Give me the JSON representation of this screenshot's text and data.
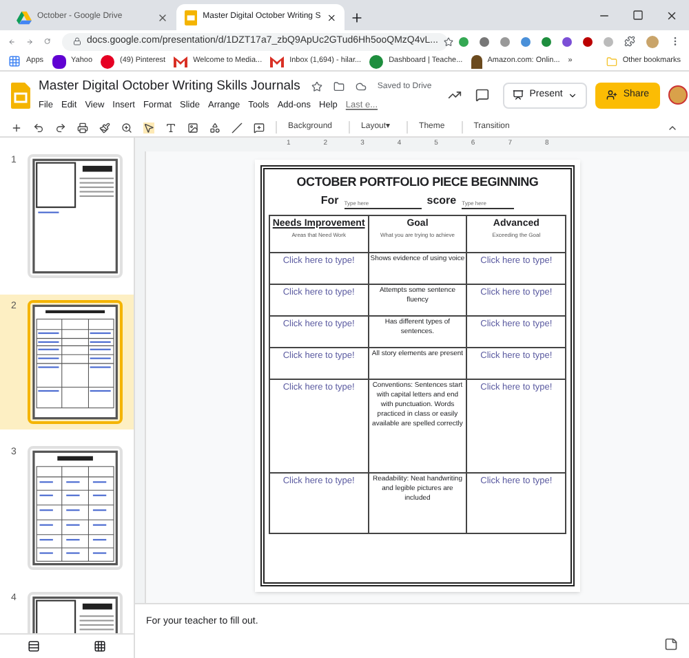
{
  "browser": {
    "tabs": [
      {
        "title": "October - Google Drive",
        "selected": false,
        "kind": "drive"
      },
      {
        "title": "Master Digital October Writing S",
        "selected": true,
        "kind": "slides"
      }
    ],
    "url": "docs.google.com/presentation/d/1DZT17a7_zbQ9ApUc2GTud6Hh5ooQMzQ4vL...",
    "bookmarks": [
      {
        "label": "Apps",
        "kind": "apps"
      },
      {
        "label": "Yahoo",
        "kind": "yahoo"
      },
      {
        "label": "(49) Pinterest",
        "kind": "pinterest"
      },
      {
        "label": "Welcome to Media...",
        "kind": "mail"
      },
      {
        "label": "Inbox (1,694) - hilar...",
        "kind": "mail"
      },
      {
        "label": "Dashboard | Teache...",
        "kind": "dash"
      },
      {
        "label": "Amazon.com: Onlin...",
        "kind": "amazon"
      }
    ],
    "more": "»",
    "other_bookmarks": "Other bookmarks"
  },
  "app": {
    "title": "Master Digital October Writing Skills Journals",
    "save_status": "Saved to Drive",
    "menus": [
      "File",
      "Edit",
      "View",
      "Insert",
      "Format",
      "Slide",
      "Arrange",
      "Tools",
      "Add-ons",
      "Help"
    ],
    "last_edit": "Last e...",
    "present": "Present",
    "share": "Share"
  },
  "toolbar": {
    "items": [
      "Background",
      "Layout▾",
      "Theme",
      "Transition"
    ]
  },
  "ruler": [
    "1",
    "2",
    "3",
    "4",
    "5",
    "6",
    "7",
    "8"
  ],
  "filmstrip": [
    {
      "number": "1",
      "selected": false,
      "kind": "cover"
    },
    {
      "number": "2",
      "selected": true,
      "kind": "rubric"
    },
    {
      "number": "3",
      "selected": false,
      "kind": "grid"
    },
    {
      "number": "4",
      "selected": false,
      "kind": "cover"
    }
  ],
  "slide": {
    "title": "OCTOBER PORTFOLIO PIECE BEGINNING",
    "for_label": "For",
    "for_placeholder": "Type here",
    "score_label": "score",
    "score_placeholder": "Type here",
    "columns": [
      {
        "heading": "Needs Improvement",
        "subheading": "Areas that Need Work"
      },
      {
        "heading": "Goal",
        "subheading": "What you are trying to achieve"
      },
      {
        "heading": "Advanced",
        "subheading": "Exceeding the Goal"
      }
    ],
    "rows": [
      {
        "left": "Click here to type!",
        "goal": "Shows evidence of using voice",
        "right": "Click here to type!"
      },
      {
        "left": "Click here to type!",
        "goal": "Attempts some sentence fluency",
        "right": "Click here to type!"
      },
      {
        "left": "Click here to type!",
        "goal": "Has different types of sentences.",
        "right": "Click here to type!"
      },
      {
        "left": "Click here to type!",
        "goal": "All story elements are present",
        "right": "Click here to type!"
      },
      {
        "left": "Click here to type!",
        "goal": "Conventions: Sentences start with capital letters and end with punctuation. Words practiced in class or easily available are spelled correctly",
        "right": "Click here to type!"
      },
      {
        "left": "Click here to type!",
        "goal": "Readability: Neat handwriting and legible pictures are included",
        "right": "Click here to type!"
      }
    ]
  },
  "notes": "For your teacher to fill out."
}
